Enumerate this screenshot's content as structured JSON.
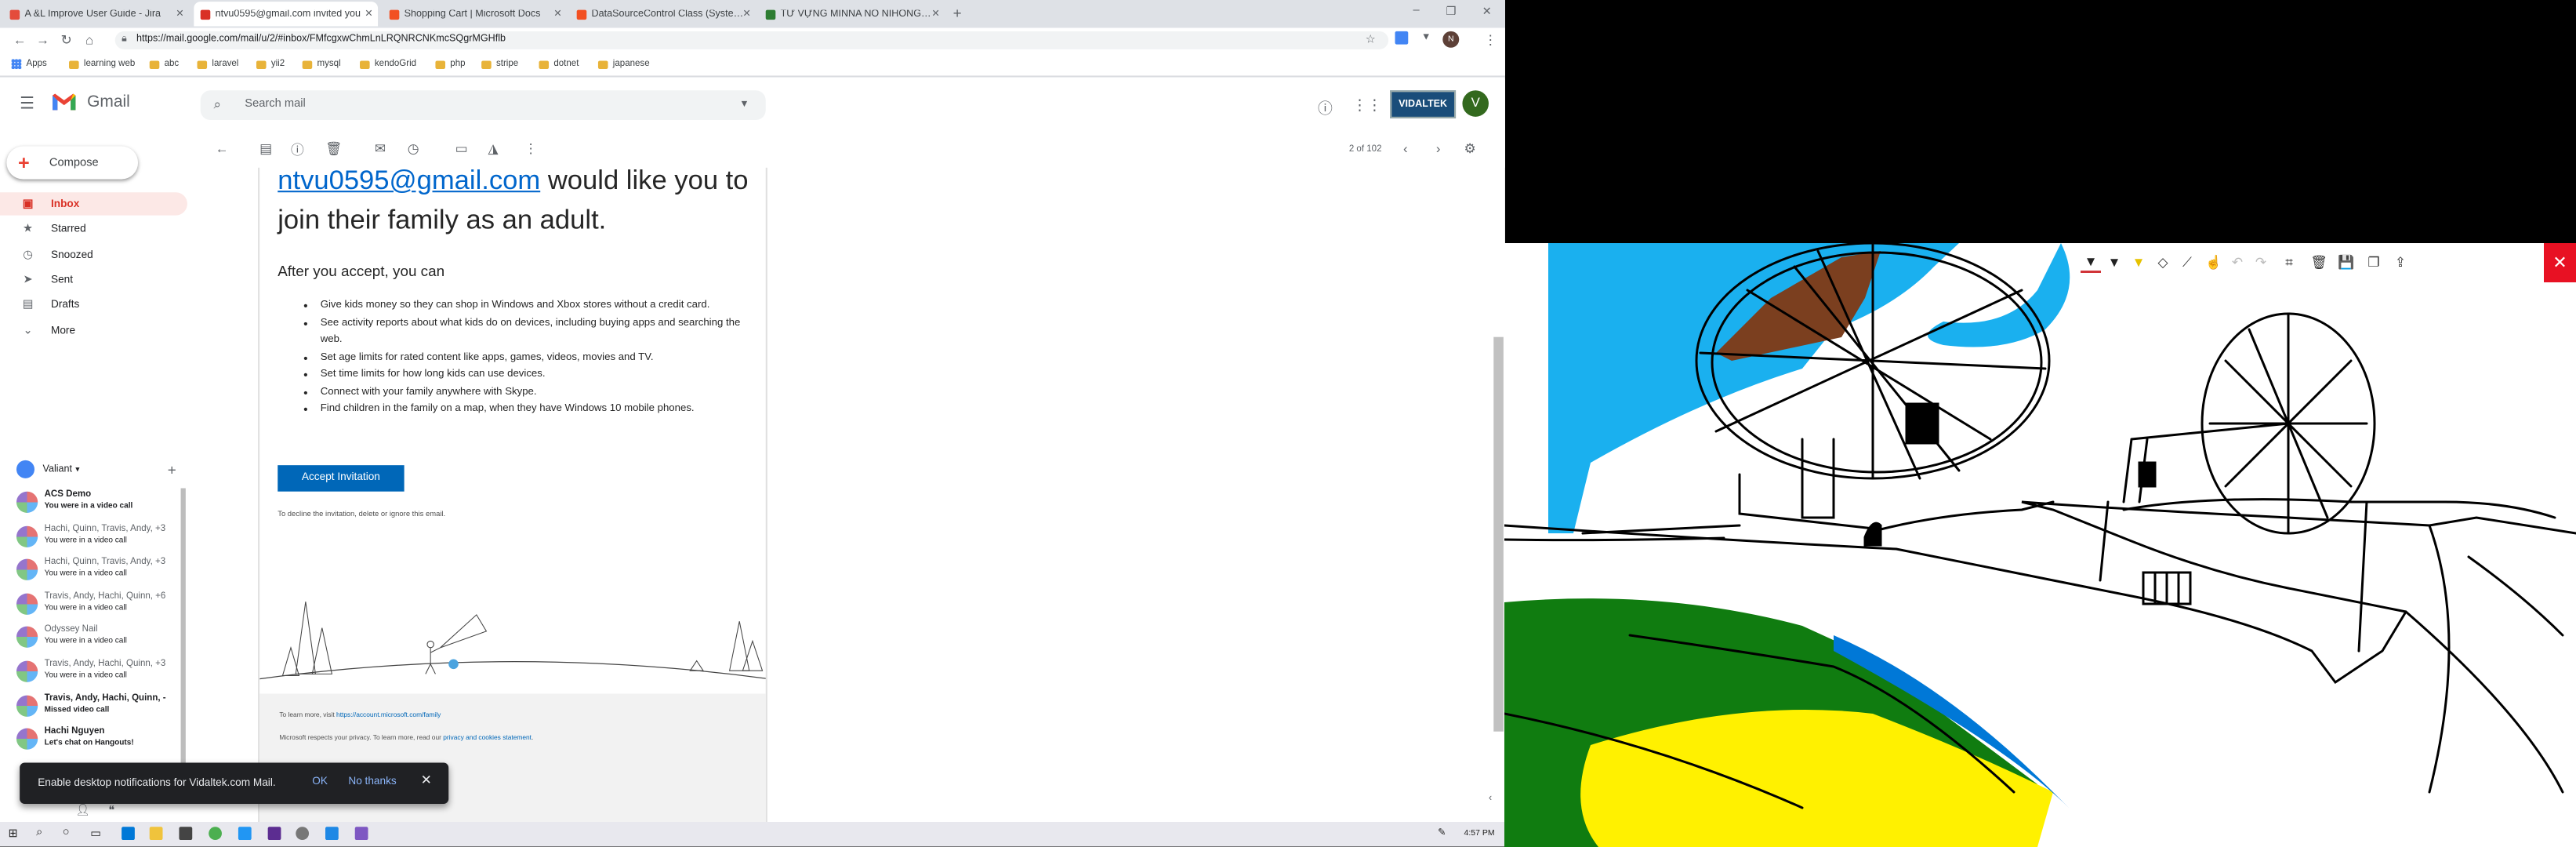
{
  "tabs": [
    {
      "label": "A &L Improve User Guide - Jira",
      "favicon_color": "#e44c3b",
      "active": false
    },
    {
      "label": "ntvu0595@gmail.com invited you",
      "favicon_color": "#d93025",
      "active": true
    },
    {
      "label": "Shopping Cart | Microsoft Docs",
      "favicon_color": "#f25022",
      "active": false
    },
    {
      "label": "DataSourceControl Class (System...",
      "favicon_color": "#f25022",
      "active": false
    },
    {
      "label": "TỪ VỰNG MINNA NO NIHONGO...",
      "favicon_color": "#2e7d32",
      "active": false
    }
  ],
  "url": "https://mail.google.com/mail/u/2/#inbox/FMfcgxwChmLnLRQNRCNKmcSQgrMGHflb",
  "bookmarks": [
    "Apps",
    "learning web",
    "abc",
    "laravel",
    "yii2",
    "mysql",
    "kendoGrid",
    "php",
    "stripe",
    "dotnet",
    "japanese"
  ],
  "gmail": {
    "product": "Gmail",
    "search_placeholder": "Search mail",
    "brand_badge": "VIDALTEK",
    "account_initial": "V",
    "compose": "Compose",
    "nav": [
      {
        "label": "Inbox",
        "icon": "inbox-icon",
        "glyph": "▣",
        "active": true
      },
      {
        "label": "Starred",
        "icon": "star-icon",
        "glyph": "★",
        "active": false
      },
      {
        "label": "Snoozed",
        "icon": "clock-icon",
        "glyph": "◷",
        "active": false
      },
      {
        "label": "Sent",
        "icon": "send-icon",
        "glyph": "➤",
        "active": false
      },
      {
        "label": "Drafts",
        "icon": "draft-icon",
        "glyph": "▤",
        "active": false
      },
      {
        "label": "More",
        "icon": "chevron-down-icon",
        "glyph": "⌄",
        "active": false
      }
    ],
    "hangouts_user": "Valiant",
    "hangouts": [
      {
        "name": "ACS Demo",
        "message": "You were in a video call",
        "name_bold": true,
        "msg_bold": true
      },
      {
        "name": "Hachi, Quinn, Travis, Andy, +3",
        "message": "You were in a video call",
        "name_bold": false,
        "msg_bold": false
      },
      {
        "name": "Hachi, Quinn, Travis, Andy, +3",
        "message": "You were in a video call",
        "name_bold": false,
        "msg_bold": false
      },
      {
        "name": "Travis, Andy, Hachi, Quinn, +6",
        "message": "You were in a video call",
        "name_bold": false,
        "msg_bold": false
      },
      {
        "name": "Odyssey Nail",
        "message": "You were in a video call",
        "name_bold": false,
        "msg_bold": false
      },
      {
        "name": "Travis, Andy, Hachi, Quinn, +3",
        "message": "You were in a video call",
        "name_bold": false,
        "msg_bold": false
      },
      {
        "name": "Travis, Andy, Hachi, Quinn, -",
        "message": "Missed video call",
        "name_bold": true,
        "msg_bold": true
      },
      {
        "name": "Hachi Nguyen",
        "message": "Let's chat on Hangouts!",
        "name_bold": true,
        "msg_bold": true
      }
    ],
    "pager": "2 of 102",
    "email": {
      "heading_link": "ntvu0595@gmail.com",
      "heading_rest_1": " would like you to",
      "heading_rest_2": "join their family as an adult.",
      "subheading": "After you accept, you can",
      "bullets": [
        "Give kids money so they can shop in Windows and Xbox stores without a credit card.",
        "See activity reports about what kids do on devices, including buying apps and searching the web.",
        "Set age limits for rated content like apps, games, videos, movies and TV.",
        "Set time limits for how long kids can use devices.",
        "Connect with your family anywhere with Skype.",
        "Find children in the family on a map, when they have Windows 10 mobile phones."
      ],
      "accept_button": "Accept Invitation",
      "decline_text": "To decline the invitation, delete or ignore this email.",
      "learn_more_prefix": "To learn more, visit ",
      "learn_more_link": "https://account.microsoft.com/family",
      "privacy_prefix": "Microsoft respects your privacy. To learn more, read our ",
      "privacy_link": "privacy and cookies statement",
      "privacy_suffix": "."
    },
    "snackbar": {
      "text": "Enable desktop notifications for Vidaltek.com Mail.",
      "ok": "OK",
      "no_thanks": "No thanks"
    }
  },
  "taskbar_clock": "4:57 PM",
  "drawing": {
    "colors": {
      "sky": "#1ab0ef",
      "roof": "#7b3f1f",
      "grass": "#107c10",
      "yellow": "#fff100",
      "blue": "#0078d7",
      "close": "#e81123"
    },
    "tools": [
      {
        "icon": "ballpoint-pen-icon",
        "glyph": "▼",
        "state": "selected"
      },
      {
        "icon": "pencil-icon",
        "glyph": "▼",
        "state": "normal"
      },
      {
        "icon": "highlighter-icon",
        "glyph": "▼",
        "state": "normal"
      },
      {
        "icon": "eraser-icon",
        "glyph": "◇",
        "state": "normal"
      },
      {
        "icon": "ruler-icon",
        "glyph": "⟋",
        "state": "normal"
      },
      {
        "icon": "touch-writing-icon",
        "glyph": "☝",
        "state": "normal"
      },
      {
        "icon": "undo-icon",
        "glyph": "↶",
        "state": "dim"
      },
      {
        "icon": "redo-icon",
        "glyph": "↷",
        "state": "dim"
      },
      {
        "icon": "crop-icon",
        "glyph": "⌗",
        "state": "normal"
      },
      {
        "icon": "delete-icon",
        "glyph": "🗑",
        "state": "normal"
      },
      {
        "icon": "save-icon",
        "glyph": "💾",
        "state": "normal"
      },
      {
        "icon": "copy-icon",
        "glyph": "❐",
        "state": "normal"
      },
      {
        "icon": "share-icon",
        "glyph": "⇪",
        "state": "normal"
      }
    ]
  }
}
